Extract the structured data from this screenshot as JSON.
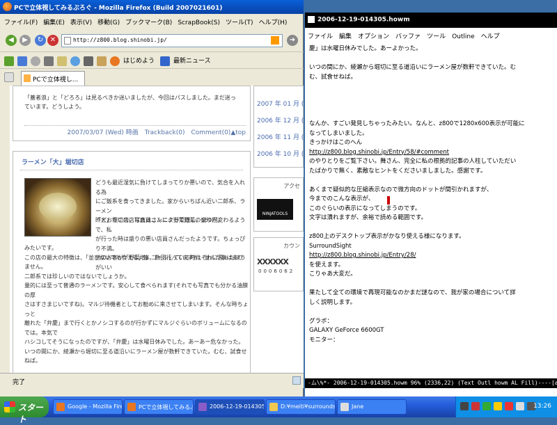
{
  "firefox": {
    "title": "PCで立体視してみるぶろぐ - Mozilla Firefox (Build 2007021601)",
    "menu": [
      "ファイル(F)",
      "編集(E)",
      "表示(V)",
      "移動(G)",
      "ブックマーク(B)",
      "ScrapBook(S)",
      "ツール(T)",
      "ヘルプ(H)"
    ],
    "url": "http://z800.blog.shinobi.jp/",
    "bookmarks": [
      "はじめよう",
      "最新ニュース"
    ],
    "tab_label": "PCで立体視し...",
    "status": "完了"
  },
  "blog": {
    "post1_text": "「蓋者浪」と「どろろ」は見るべきか迷いましたが、今回はパスしました。まだ迷っています。どうしよう。",
    "post1_footer": "2007/03/07 (Wed) 時画　Trackback(0)　Comment(0)▲top",
    "post2_title": "ラーメン「大」堀切店",
    "post2_lines_right": [
      "どうも最近湿気に負けてしまってりか悪いので、気合を入れる為",
      "にご飯系を食ってきました。家からいちばん近い二郎系、ラーメン",
      "「大」堀切店。写真はニンニク野菜増し。550円。"
    ],
    "post2_lines_right2": [
      "昨どおりこの店は店員さんによって野菜の盛りが変わるようで、私",
      "が行った時は盛りの悪い店員さんだったようです。ちょっぴり不満。",
      "他のお客が「野菜増」コールしている時はそれに習ったほうがいい"
    ],
    "post2_lines_full": [
      "みたいです。",
      "",
      "この店の最大の特徴は、「並びないでも食える」事。数回行ってますが、並んだ事はありません。",
      "二郎系では珍しいのではないでしょうか。",
      "量的には至って普通のラーメンです。安心して食べられます(それでも写真でも分かる油膜の厚",
      "さはすさまじいですね)。マルジ待機者としてお勧めに来させてしまいます。そんな時ちょっと",
      "離れた「弁慶」まで行くとかノシコするのが行かずにマルジぐらいのボリュームになるのでは。本気で",
      "ハシコしてそうになったのですが、「弁慶」は水曜日休みでした。あーあー危なかった。",
      "",
      "いつの間にか、綾瀬から堀切に至る道沿いにラーメン屋が数軒できていた。むむ、試食せねば。"
    ],
    "sidebar_archive": [
      "2007 年 01 月 ( 2",
      "2006 年 12 月 ( 3",
      "2006 年 11 月 ( 2",
      "2006 年 10 月 ( 2"
    ],
    "sidebar_access": "アクセ",
    "sidebar_counter": "カウン",
    "ninja_label": "NINJATOOLS",
    "counter_digits": "0006062"
  },
  "howm": {
    "title": "2006-12-19-014305.howm",
    "menu": [
      "ファイル",
      "編集",
      "オプション",
      "バッファ",
      "ツール",
      "Outline",
      "ヘルプ"
    ],
    "lines": [
      "慶」は水曜日休みでした。あーよかった。",
      "",
      "いつの間にか、綾瀬から堀切に至る道沿いにラーメン屋が数軒できていた。む",
      "む、試食せねば。",
      "",
      "",
      "",
      "",
      "なんか、すごい発見しちゃったみたい。なんと、z800で1280x600表示が可能に",
      "なってしまいました。",
      "きっかけはこのへん",
      "http://z800.blog.shinobi.jp/Entry/58/#comment",
      "のやりとりをご覧下さい。舞さん、完全に私の根拠的記事の人柱していただい",
      "たばかりで無く、素敵なヒントをくださいましました。感謝です。",
      "",
      "あくまで疑似的な圧縮表示なので微方向のドットが間引かれますが、",
      "今までのこんな表示が、",
      "このぐらいの表示になってしまうのです。",
      "文字は潰れますが、余裕で読める範囲です。",
      "",
      "z800上のデスクトップ表示がかなり使える様になります。",
      "SurroundSight",
      "http://z800.blog.shinobi.jp/Entry/28/",
      "を使えます。",
      "こりゃあ大変だ。",
      "",
      "果たして全ての環境で再現可能なのかまだ謎なので、我が家の場合について詳",
      "しく説明します。",
      "",
      "グラボ：",
      "GALAXY GeForce 6600GT",
      "モニター："
    ],
    "modeline": "-ム\\%*-  2006-12-19-014305.howm   96% (2336,22)   (Text Outl howm AL Fill)----[a]-----------"
  },
  "taskbar": {
    "start": "スタート",
    "buttons": [
      "Google - Mozilla Fire...",
      "PCで立体視してみるぶ...",
      "2006-12-19-014305.h...",
      "D:¥meiti¥surroundsigh...",
      "Jane"
    ],
    "clock": "13:26"
  }
}
